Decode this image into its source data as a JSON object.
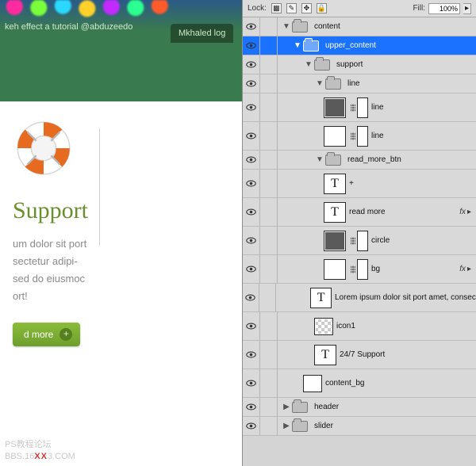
{
  "options": {
    "lock_label": "Lock:",
    "fill_label": "Fill:",
    "fill_value": "100%"
  },
  "design": {
    "banner_link": "keh effect a tutorial @abduzeedo",
    "banner_tab": "Mkhaled log",
    "heading": "Support",
    "paragraph": "um dolor sit port\nsectetur adipi-\nsed do eiusmoc\nort!",
    "button_label": "d more",
    "button_plus": "+",
    "watermark_line1": "PS教程论坛",
    "watermark_prefix": "BBS.16",
    "watermark_xx": "XX",
    "watermark_suffix": "3.COM"
  },
  "layers": {
    "content": "content",
    "upper_content": "upper_content",
    "support": "support",
    "line_group": "line",
    "line1": "line",
    "line2": "line",
    "read_more_btn": "read_more_btn",
    "plus": "+",
    "read_more": "read more",
    "circle": "circle",
    "bg": "bg",
    "lorem": "Lorem ipsum dolor sit port amet, consec…",
    "icon1": "icon1",
    "support247": "24/7 Support",
    "content_bg": "content_bg",
    "header": "header",
    "slider": "slider",
    "fx": "fx"
  }
}
